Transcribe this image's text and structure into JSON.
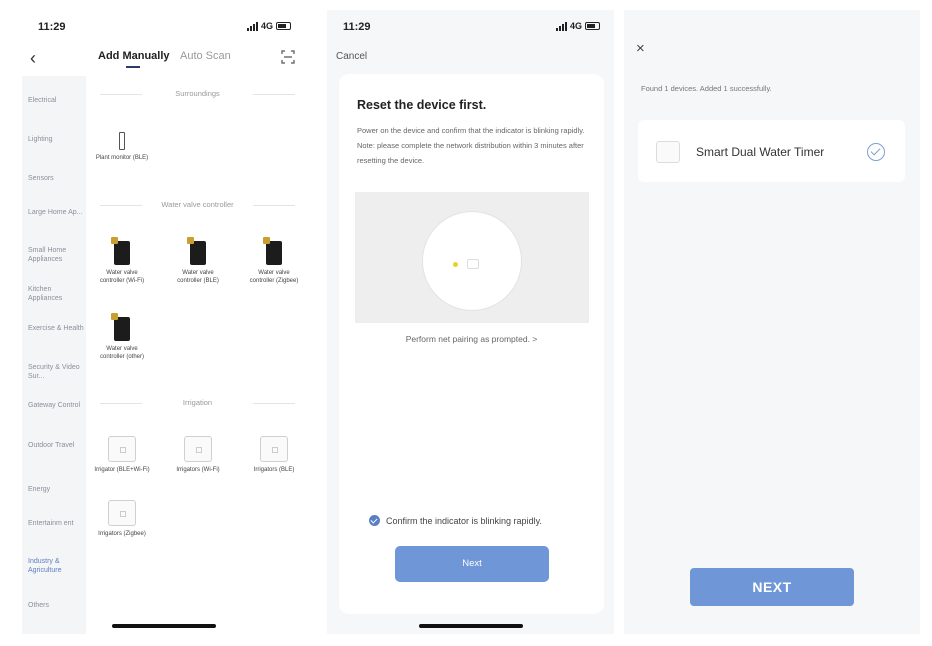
{
  "status": {
    "time": "11:29",
    "network": "4G"
  },
  "screen1": {
    "tabs": {
      "manual": "Add Manually",
      "auto": "Auto Scan"
    },
    "sidebar": [
      "Electrical",
      "Lighting",
      "Sensors",
      "Large Home Ap...",
      "Small Home Appliances",
      "Kitchen Appliances",
      "Exercise & Health",
      "Security & Video Sur...",
      "Gateway Control",
      "Outdoor Travel",
      "Energy",
      "Entertainm ent",
      "Industry & Agriculture",
      "Others"
    ],
    "sidebar_active_index": 12,
    "sections": {
      "surroundings": "Surroundings",
      "water_valve": "Water valve controller",
      "irrigation": "Irrigation"
    },
    "devices": {
      "plant_monitor": "Plant monitor (BLE)",
      "valve_wifi": "Water valve controller (Wi-Fi)",
      "valve_ble": "Water valve controller (BLE)",
      "valve_zigbee": "Water valve controller (Zigbee)",
      "valve_other": "Water valve controller (other)",
      "irr_ble_wifi": "Irrigator (BLE+Wi-Fi)",
      "irr_wifi": "Irrigators (Wi-Fi)",
      "irr_ble": "Irrigators (BLE)",
      "irr_zigbee": "Irrigators (Zigbee)"
    }
  },
  "screen2": {
    "cancel": "Cancel",
    "title": "Reset the device first.",
    "desc": "Power on the device and confirm that the indicator is blinking rapidly. Note: please complete the network distribution within 3 minutes after resetting the device.",
    "pair_link": "Perform net pairing as prompted. >",
    "confirm": "Confirm the indicator is blinking rapidly.",
    "next": "Next"
  },
  "screen3": {
    "close": "×",
    "found": "Found 1 devices. Added 1 successfully.",
    "device_name": "Smart Dual Water Timer",
    "next": "NEXT"
  },
  "colors": {
    "accent": "#6f96d6",
    "active_side": "#5b7fc4"
  }
}
